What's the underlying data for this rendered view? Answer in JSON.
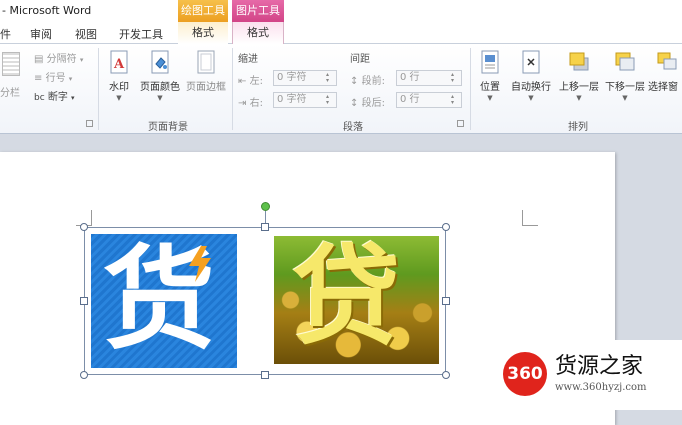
{
  "titlebar": {
    "title": "- Microsoft Word",
    "ctx_drawing": "绘图工具",
    "ctx_picture": "图片工具"
  },
  "tabs": {
    "items": [
      "件",
      "审阅",
      "视图",
      "开发工具"
    ],
    "ctx_drawing_format": "格式",
    "ctx_picture_format": "格式"
  },
  "ribbon": {
    "page_setup": {
      "columns": "分栏",
      "breaks": "分隔符",
      "line_numbers": "行号",
      "hyphenation": "断字"
    },
    "page_background": {
      "label": "页面背景",
      "watermark": "水印",
      "page_color": "页面颜色",
      "page_borders": "页面边框"
    },
    "paragraph": {
      "label": "段落",
      "indent_title": "缩进",
      "indent_left": "左:",
      "indent_right": "右:",
      "indent_left_value": "0 字符",
      "indent_right_value": "0 字符",
      "spacing_title": "间距",
      "spacing_before": "段前:",
      "spacing_after": "段后:",
      "spacing_before_value": "0 行",
      "spacing_after_value": "0 行"
    },
    "arrange": {
      "label": "排列",
      "position": "位置",
      "wrap_text": "自动换行",
      "bring_forward": "上移一层",
      "send_backward": "下移一层",
      "selection_pane": "选择窗"
    }
  },
  "document": {
    "image1_char": "货",
    "image2_char": "贷"
  },
  "watermark": {
    "logo": "360",
    "name": "货源之家",
    "url": "www.360hyzj.com"
  },
  "colors": {
    "ctx_drawing": "#f0a830",
    "ctx_picture": "#d94a90",
    "image1_bg": "#2a85de",
    "bolt": "#f5a020",
    "logo_red": "#e0241c"
  }
}
